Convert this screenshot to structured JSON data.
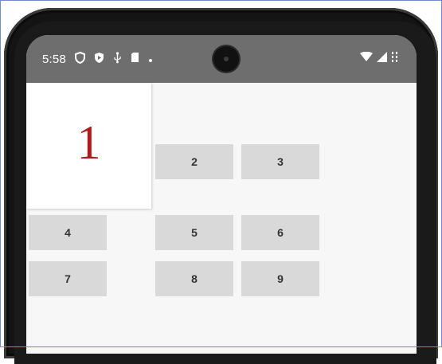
{
  "status_bar": {
    "time": "5:58",
    "left_icons": [
      "shield-icon",
      "play-protect-icon",
      "usb-debug-icon",
      "sd-card-icon",
      "dot-icon"
    ],
    "right_icons": [
      "wifi-icon",
      "cellular-signal-icon",
      "battery-icon"
    ]
  },
  "display": {
    "value": "1",
    "color": "#b21a1a"
  },
  "keys": [
    {
      "label": "2"
    },
    {
      "label": "3"
    },
    {
      "label": "4"
    },
    {
      "label": "5"
    },
    {
      "label": "6"
    },
    {
      "label": "7"
    },
    {
      "label": "8"
    },
    {
      "label": "9"
    }
  ]
}
